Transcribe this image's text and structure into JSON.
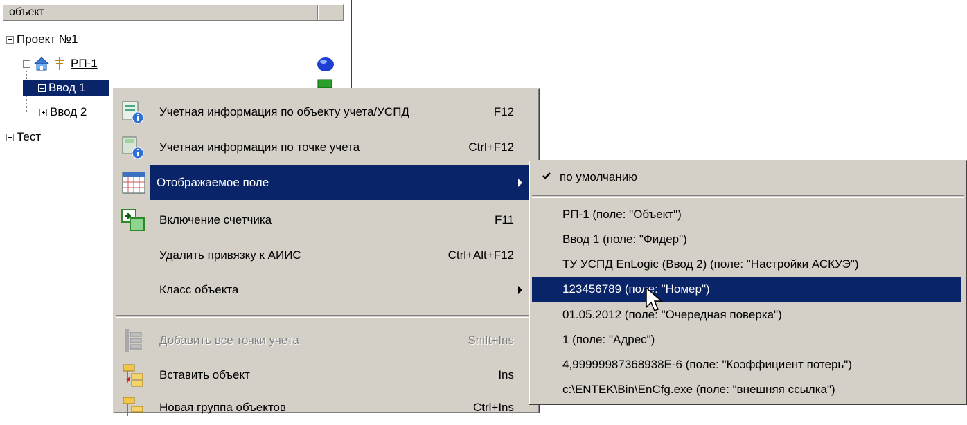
{
  "tree": {
    "header": "объект",
    "nodes": {
      "project": "Проект №1",
      "rp": "РП-1",
      "vvod1": "Ввод 1",
      "vvod2": "Ввод 2",
      "test": "Тест"
    }
  },
  "context_menu": {
    "items": [
      {
        "label": "Учетная информация по объекту учета/УСПД",
        "shortcut": "F12"
      },
      {
        "label": "Учетная информация по точке учета",
        "shortcut": "Ctrl+F12"
      },
      {
        "label": "Отображаемое поле",
        "shortcut": ""
      },
      {
        "label": "Включение счетчика",
        "shortcut": "F11"
      },
      {
        "label": "Удалить привязку к АИИС",
        "shortcut": "Ctrl+Alt+F12"
      },
      {
        "label": "Класс объекта",
        "shortcut": ""
      },
      {
        "label": "Добавить все точки учета",
        "shortcut": "Shift+Ins"
      },
      {
        "label": "Вставить объект",
        "shortcut": "Ins"
      },
      {
        "label": "Новая группа объектов",
        "shortcut": "Ctrl+Ins"
      }
    ]
  },
  "submenu": {
    "items": [
      {
        "label": "по умолчанию",
        "checked": true
      },
      {
        "label": "РП-1  (поле: \"Объект\")"
      },
      {
        "label": "Ввод 1  (поле: \"Фидер\")"
      },
      {
        "label": "ТУ УСПД EnLogic (Ввод 2)  (поле: \"Настройки АСКУЭ\")"
      },
      {
        "label": "123456789  (поле: \"Номер\")"
      },
      {
        "label": "01.05.2012  (поле: \"Очередная поверка\")"
      },
      {
        "label": "1  (поле: \"Адрес\")"
      },
      {
        "label": "4,99999987368938E-6  (поле: \"Коэффициент потерь\")"
      },
      {
        "label": "c:\\ENTEK\\Bin\\EnCfg.exe  (поле: \"внешняя ссылка\")"
      }
    ]
  },
  "colors": {
    "menu_bg": "#d4d0c8",
    "selection": "#0a246a",
    "disabled_text": "#808080"
  }
}
